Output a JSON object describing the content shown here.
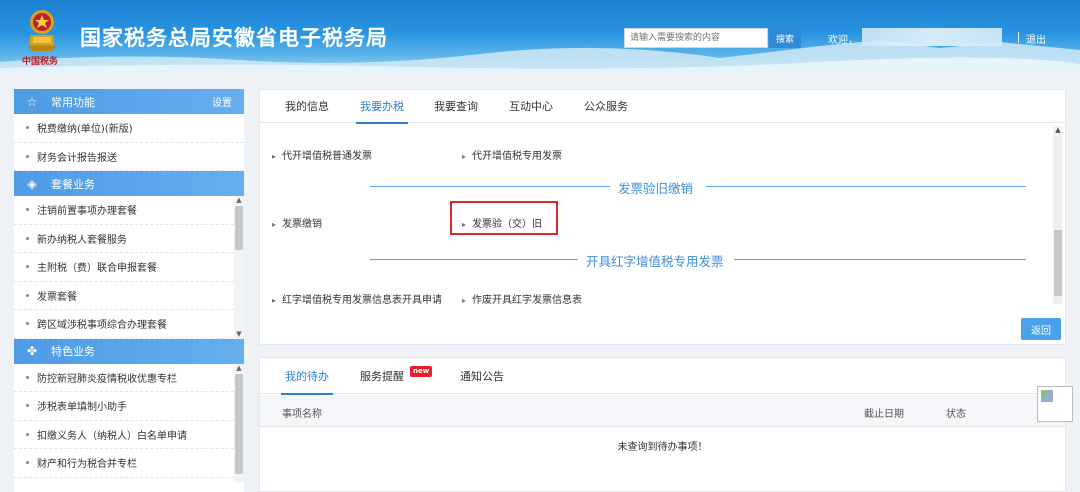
{
  "header": {
    "title": "国家税务总局安徽省电子税务局",
    "emblem_caption": "中国税务",
    "search_placeholder": "请输入需要搜索的内容",
    "search_button": "搜索",
    "welcome": "欢迎，",
    "logout": "退出"
  },
  "sidebar": {
    "sections": [
      {
        "title": "常用功能",
        "icon": "star-icon",
        "setting": "设置",
        "items": [
          "税费缴纳(单位)(新版)",
          "财务会计报告报送"
        ]
      },
      {
        "title": "套餐业务",
        "icon": "layers-icon",
        "items": [
          "注销前置事项办理套餐",
          "新办纳税人套餐服务",
          "主附税（费）联合申报套餐",
          "发票套餐",
          "跨区域涉税事项综合办理套餐"
        ]
      },
      {
        "title": "特色业务",
        "icon": "clover-icon",
        "items": [
          "防控新冠肺炎疫情税收优惠专栏",
          "涉税表单填制小助手",
          "扣缴义务人（纳税人）白名单申请",
          "财产和行为税合并专栏"
        ]
      }
    ]
  },
  "main": {
    "tabs": [
      "我的信息",
      "我要办税",
      "我要查询",
      "互动中心",
      "公众服务"
    ],
    "active_tab": "我要办税",
    "row1": [
      "代开增值税普通发票",
      "代开增值税专用发票"
    ],
    "group1_title": "发票验旧缴销",
    "row2": [
      "发票缴销",
      "发票验（交）旧"
    ],
    "group2_title": "开具红字增值税专用发票",
    "row3": [
      "红字增值税专用发票信息表开具申请",
      "作废开具红字发票信息表"
    ],
    "return_button": "返回"
  },
  "todo": {
    "tabs": [
      "我的待办",
      "服务提醒",
      "通知公告"
    ],
    "badge": "new",
    "columns": [
      "事项名称",
      "截止日期",
      "状态"
    ],
    "empty_message": "未查询到待办事项！"
  },
  "colors": {
    "accent": "#2b7fd4",
    "highlight_border": "#e0252b",
    "section_header": "#4e9ce6"
  }
}
